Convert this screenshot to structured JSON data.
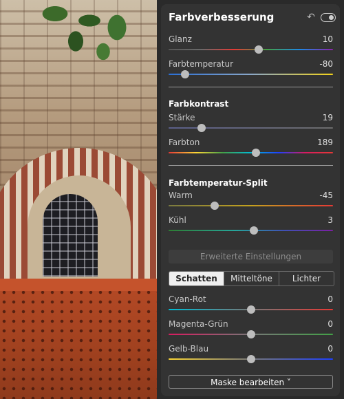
{
  "panel": {
    "title": "Farbverbesserung",
    "icons": {
      "reset": "undo-icon",
      "visibility": "eye-toggle-icon"
    }
  },
  "sliders": {
    "glanz": {
      "label": "Glanz",
      "value": "10",
      "position": 0.55
    },
    "farbtemperatur": {
      "label": "Farbtemperatur",
      "value": "-80",
      "position": 0.1
    },
    "staerke": {
      "label": "Stärke",
      "value": "19",
      "position": 0.2
    },
    "farbton": {
      "label": "Farbton",
      "value": "189",
      "position": 0.53
    },
    "warm": {
      "label": "Warm",
      "value": "-45",
      "position": 0.28
    },
    "kuehl": {
      "label": "Kühl",
      "value": "3",
      "position": 0.52
    },
    "cyan_rot": {
      "label": "Cyan-Rot",
      "value": "0",
      "position": 0.5
    },
    "magenta_gruen": {
      "label": "Magenta-Grün",
      "value": "0",
      "position": 0.5
    },
    "gelb_blau": {
      "label": "Gelb-Blau",
      "value": "0",
      "position": 0.5
    }
  },
  "sections": {
    "farbkontrast": "Farbkontrast",
    "split": "Farbtemperatur-Split"
  },
  "buttons": {
    "erweitert": "Erweiterte Einstellungen",
    "maske": "Maske bearbeiten ˅"
  },
  "tabs": [
    "Schatten",
    "Mitteltöne",
    "Lichter"
  ],
  "colors": {
    "panel_bg": "#333333",
    "thumb": "#bdbdbd",
    "active_tab": "#efefef"
  }
}
